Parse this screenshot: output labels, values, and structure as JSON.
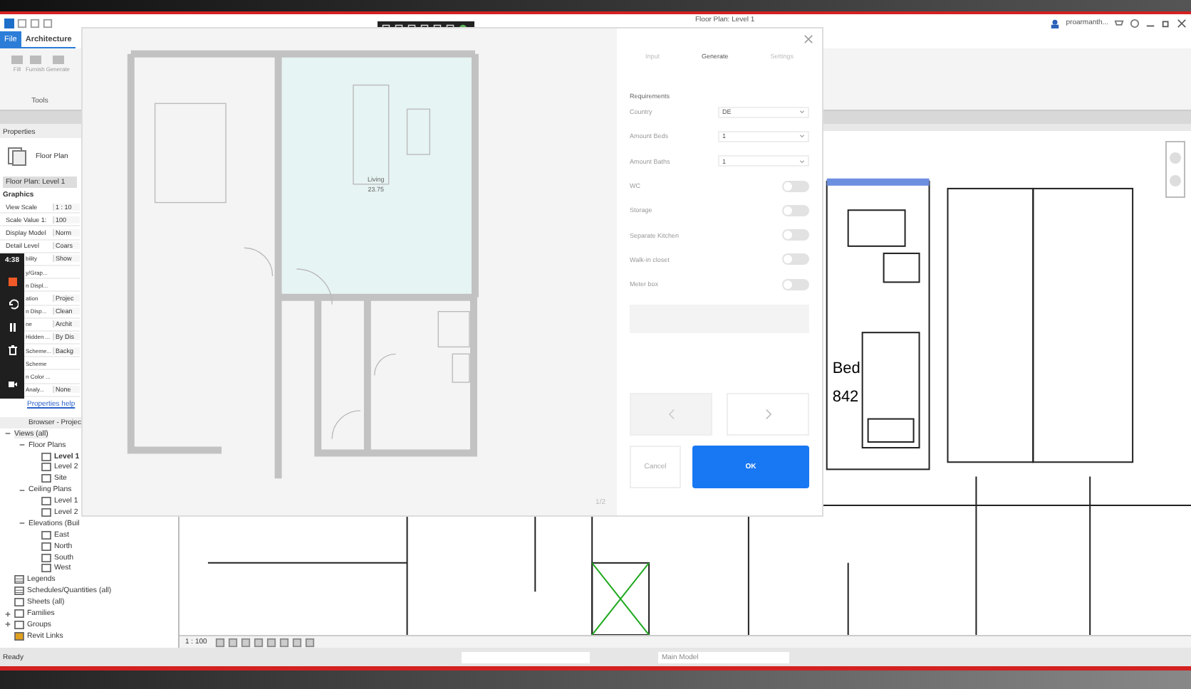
{
  "title_bar": {
    "title": "Floor Plan: Level 1",
    "user": "proarmanth..."
  },
  "ribbon": {
    "tabs": [
      {
        "label": "File",
        "kind": "file",
        "selected": false
      },
      {
        "label": "Architecture",
        "kind": "tab",
        "selected": true
      }
    ],
    "tools": [
      "Fill",
      "Furnish",
      "Generate"
    ],
    "panel_label": "Tools"
  },
  "properties": {
    "title": "Properties",
    "type_name": "Floor Plan",
    "selector": "Floor Plan: Level 1",
    "group": "Graphics",
    "rows": [
      {
        "name": "View Scale",
        "value": "1 : 10"
      },
      {
        "name": "Scale Value  1:",
        "value": "100"
      },
      {
        "name": "Display Model",
        "value": "Norm"
      },
      {
        "name": "Detail Level",
        "value": "Coars"
      },
      {
        "name": "bility",
        "value": "Show"
      },
      {
        "name": "y/Grap...",
        "value": ""
      },
      {
        "name": "n Displ...",
        "value": ""
      },
      {
        "name": "ation",
        "value": "Projec"
      },
      {
        "name": "n Disp...",
        "value": "Clean"
      },
      {
        "name": "ne",
        "value": "Archit"
      },
      {
        "name": "Hidden ...",
        "value": "By Dis"
      },
      {
        "name": "Scheme...",
        "value": "Backg"
      },
      {
        "name": "Scheme",
        "value": ""
      },
      {
        "name": "n Color ...",
        "value": ""
      },
      {
        "name": "Analy...",
        "value": "None"
      }
    ],
    "help_link": "Properties help"
  },
  "recorder": {
    "time": "4:38"
  },
  "browser": {
    "title": "Browser - Projec",
    "tree": [
      {
        "label": "Views (all)",
        "kind": "root",
        "expanded": true,
        "children": [
          {
            "label": "Floor Plans",
            "kind": "folder",
            "expanded": true,
            "children": [
              {
                "label": "Level 1",
                "kind": "view",
                "selected": true
              },
              {
                "label": "Level 2",
                "kind": "view",
                "selected": false
              },
              {
                "label": "Site",
                "kind": "view",
                "selected": false
              }
            ]
          },
          {
            "label": "Ceiling Plans",
            "kind": "folder",
            "expanded": true,
            "children": [
              {
                "label": "Level 1",
                "kind": "view",
                "selected": false
              },
              {
                "label": "Level 2",
                "kind": "view",
                "selected": false
              }
            ]
          },
          {
            "label": "Elevations (Buil",
            "kind": "folder",
            "expanded": true,
            "children": [
              {
                "label": "East",
                "kind": "view",
                "selected": false
              },
              {
                "label": "North",
                "kind": "view",
                "selected": false
              },
              {
                "label": "South",
                "kind": "view",
                "selected": false
              },
              {
                "label": "West",
                "kind": "view",
                "selected": false
              }
            ]
          }
        ]
      },
      {
        "label": "Legends",
        "kind": "legend"
      },
      {
        "label": "Schedules/Quantities (all)",
        "kind": "schedule"
      },
      {
        "label": "Sheets (all)",
        "kind": "sheet"
      },
      {
        "label": "Families",
        "kind": "family",
        "expanded": false
      },
      {
        "label": "Groups",
        "kind": "group",
        "expanded": false
      },
      {
        "label": "Revit Links",
        "kind": "link"
      }
    ]
  },
  "modal": {
    "plan": {
      "rooms": [
        {
          "name": "Living",
          "area": "23.75"
        }
      ],
      "page": "1/2"
    },
    "tabs": [
      {
        "label": "Input",
        "selected": false
      },
      {
        "label": "Generate",
        "selected": true
      },
      {
        "label": "Settings",
        "selected": false
      }
    ],
    "section": "Requirements",
    "fields": [
      {
        "label": "Country",
        "value": "DE"
      },
      {
        "label": "Amount Beds",
        "value": "1"
      },
      {
        "label": "Amount Baths",
        "value": "1"
      }
    ],
    "toggles": [
      {
        "label": "WC",
        "on": false
      },
      {
        "label": "Storage",
        "on": false
      },
      {
        "label": "Separate Kitchen",
        "on": false
      },
      {
        "label": "Walk-in closet",
        "on": false
      },
      {
        "label": "Meter box",
        "on": false
      }
    ],
    "cancel": "Cancel",
    "ok": "OK"
  },
  "canvas": {
    "labels": [
      "Bed",
      "842"
    ],
    "scale": "1 : 100"
  },
  "status_bar": {
    "text": "Ready",
    "model": "Main Model"
  }
}
